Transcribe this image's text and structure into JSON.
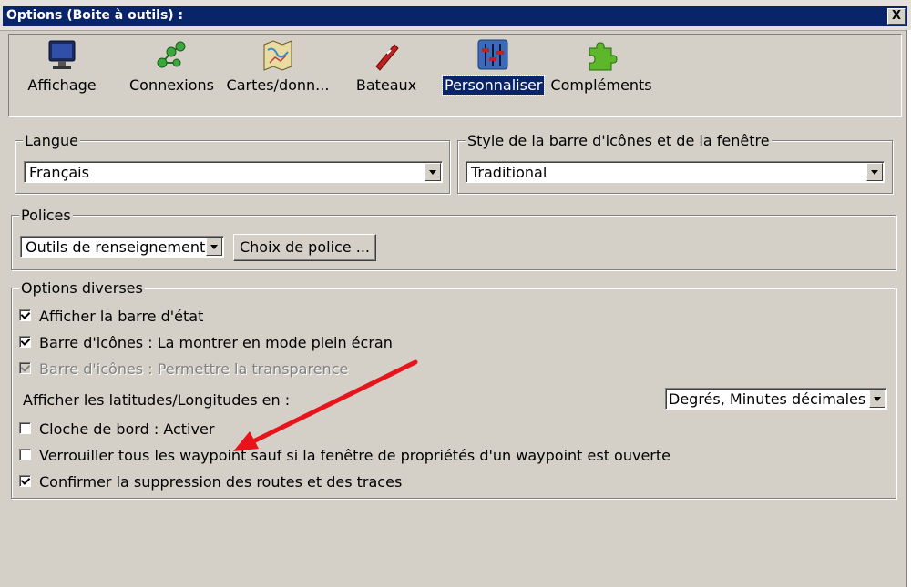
{
  "window": {
    "title": "Options (Boite à outils) :",
    "close_label": "X"
  },
  "toolbar": {
    "items": [
      {
        "label": "Affichage",
        "icon": "monitor-icon",
        "selected": false
      },
      {
        "label": "Connexions",
        "icon": "connections-icon",
        "selected": false
      },
      {
        "label": "Cartes/donn...",
        "icon": "charts-icon",
        "selected": false
      },
      {
        "label": "Bateaux",
        "icon": "boat-icon",
        "selected": false
      },
      {
        "label": "Personnaliser",
        "icon": "sliders-icon",
        "selected": true
      },
      {
        "label": "Compléments",
        "icon": "puzzle-icon",
        "selected": false
      }
    ]
  },
  "langue": {
    "legend": "Langue",
    "value": "Français"
  },
  "style": {
    "legend": "Style de la barre d'icônes et de la fenêtre",
    "value": "Traditional"
  },
  "polices": {
    "legend": "Polices",
    "value": "Outils de renseignement",
    "button_label": "Choix de police ..."
  },
  "options": {
    "legend": "Options diverses",
    "checkboxes": [
      {
        "label": "Afficher la barre d'état",
        "checked": true,
        "disabled": false
      },
      {
        "label": "Barre d'icônes : La montrer en mode plein écran",
        "checked": true,
        "disabled": false
      },
      {
        "label": "Barre d'icônes : Permettre la transparence",
        "checked": true,
        "disabled": true
      }
    ],
    "latlon_label": "Afficher les latitudes/Longitudes en :",
    "latlon_value": "Degrés, Minutes décimales",
    "checkboxes2": [
      {
        "label": "Cloche de bord : Activer",
        "checked": false,
        "disabled": false
      },
      {
        "label": "Verrouiller tous les waypoint sauf si la fenêtre de propriétés d'un waypoint est ouverte",
        "checked": false,
        "disabled": false
      },
      {
        "label": "Confirmer la suppression des routes et des traces",
        "checked": true,
        "disabled": false
      }
    ]
  },
  "annotation": {
    "arrow_color": "#e8141c"
  }
}
